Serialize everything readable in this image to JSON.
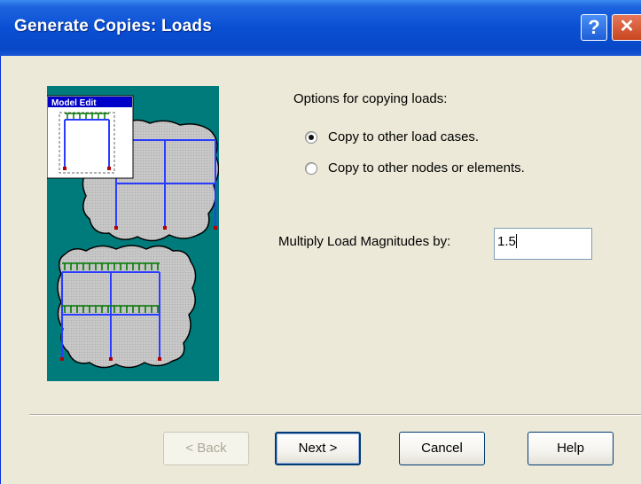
{
  "window": {
    "title": "Generate Copies: Loads",
    "help_glyph": "?",
    "close_glyph": "✕",
    "accent": "#0a4fd3"
  },
  "illustration": {
    "caption": "Model Edit",
    "background": "#007b7b"
  },
  "options": {
    "heading": "Options for copying loads:",
    "items": [
      {
        "label": "Copy to other load cases.",
        "selected": true
      },
      {
        "label": "Copy to other nodes or elements.",
        "selected": false
      }
    ]
  },
  "multiply": {
    "label": "Multiply Load Magnitudes by:",
    "value": "1.5"
  },
  "buttons": {
    "back": "< Back",
    "next": "Next >",
    "cancel": "Cancel",
    "help": "Help"
  }
}
